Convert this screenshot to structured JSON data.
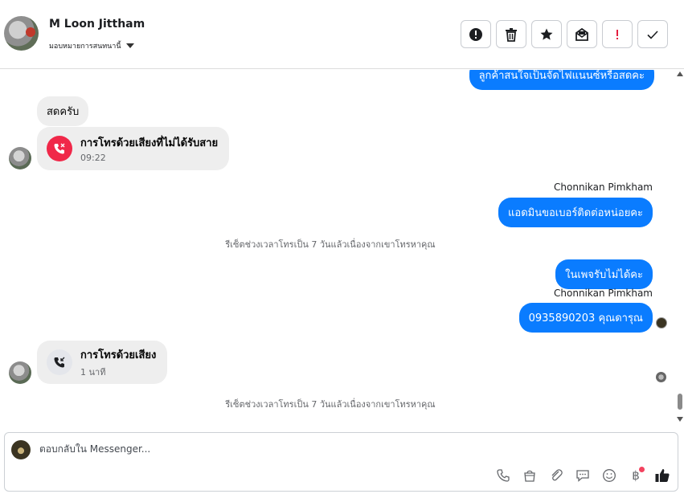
{
  "header": {
    "contact_name": "M Loon Jittham",
    "assign_label": "มอบหมายการสนทนานี้",
    "actions": [
      {
        "icon": "alert-circle-icon",
        "name": "mark-spam-button"
      },
      {
        "icon": "trash-icon",
        "name": "delete-button"
      },
      {
        "icon": "star-icon",
        "name": "star-button"
      },
      {
        "icon": "mail-icon",
        "name": "mark-unread-button"
      },
      {
        "icon": "exclamation-icon",
        "name": "follow-up-button"
      },
      {
        "icon": "check-icon",
        "name": "mark-done-button"
      }
    ]
  },
  "thread": {
    "top_partial": "ลูกค้าสนใจเป็นจัดไฟแนนซ์หรือสดคะ",
    "msg_in_1": "สดครับ",
    "missed_call": {
      "title": "การโทรด้วยเสียงที่ไม่ได้รับสาย",
      "time": "09:22"
    },
    "sender_1": "Chonnikan Pimkham",
    "msg_out_1": "แอดมินขอเบอร์ติดต่อหน่อยคะ",
    "system_1": "รีเซ็ตช่วงเวลาโทรเป็น 7 วันแล้วเนื่องจากเขาโทรหาคุณ",
    "msg_out_2": "ในเพจรับไม่ได้คะ",
    "sender_2": "Chonnikan Pimkham",
    "msg_out_3": "0935890203 คุณดารุณ",
    "voice_call": {
      "title": "การโทรด้วยเสียง",
      "duration": "1 นาที"
    },
    "system_2": "รีเซ็ตช่วงเวลาโทรเป็น 7 วันแล้วเนื่องจากเขาโทรหาคุณ"
  },
  "composer": {
    "placeholder": "ตอบกลับใน Messenger...",
    "tools": [
      "phone-icon",
      "shopping-bag-icon",
      "paperclip-icon",
      "saved-reply-icon",
      "emoji-icon",
      "baht-icon",
      "thumbs-up-icon"
    ]
  },
  "colors": {
    "outgoing_bubble": "#0a7cff",
    "incoming_bubble": "#eeeeee",
    "missed_call": "#f02849",
    "notification_dot": "#f3425f"
  }
}
